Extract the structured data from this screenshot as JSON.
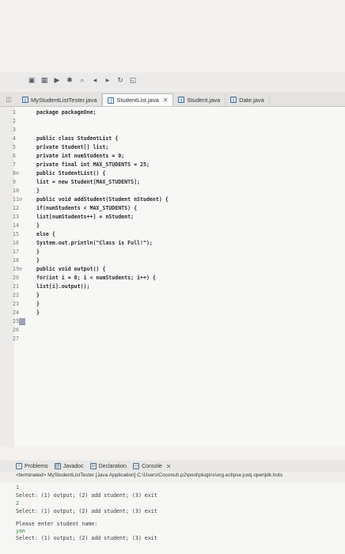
{
  "toolbar": {
    "icons": [
      "run-icon",
      "debug-icon",
      "search-icon",
      "back-icon",
      "forward-icon"
    ]
  },
  "editor_tabs": [
    {
      "label": "MyStudentListTester.java",
      "active": false
    },
    {
      "label": "StudentList.java",
      "active": true
    },
    {
      "label": "Student.java",
      "active": false
    },
    {
      "label": "Date.java",
      "active": false
    }
  ],
  "code_lines": [
    {
      "n": "1",
      "text": "package packageOne;"
    },
    {
      "n": "2",
      "text": ""
    },
    {
      "n": "3",
      "text": ""
    },
    {
      "n": "4",
      "text": "public class StudentList {"
    },
    {
      "n": "5",
      "text": "private Student[] list;"
    },
    {
      "n": "6",
      "text": "private int numStudents = 0;"
    },
    {
      "n": "7",
      "text": "private final int MAX_STUDENTS = 25;"
    },
    {
      "n": "8⊖",
      "text": "public StudentList() {"
    },
    {
      "n": "9",
      "text": "list = new Student[MAX_STUDENTS];"
    },
    {
      "n": "10",
      "text": "}"
    },
    {
      "n": "11⊖",
      "text": "public void addStudent(Student nStudent) {"
    },
    {
      "n": "12",
      "text": "if(numStudents < MAX_STUDENTS) {"
    },
    {
      "n": "13",
      "text": "list[numStudents++] = nStudent;"
    },
    {
      "n": "14",
      "text": "}"
    },
    {
      "n": "15",
      "text": "else {"
    },
    {
      "n": "16",
      "text": "System.out.println(\"Class is Full!\");"
    },
    {
      "n": "17",
      "text": "}"
    },
    {
      "n": "18",
      "text": "}"
    },
    {
      "n": "19⊖",
      "text": "public void output() {"
    },
    {
      "n": "20",
      "text": "for(int i = 0; i < numStudents; i++) {"
    },
    {
      "n": "21",
      "text": "list[i].output();"
    },
    {
      "n": "22",
      "text": "}"
    },
    {
      "n": "23",
      "text": "}"
    },
    {
      "n": "24",
      "text": "}"
    },
    {
      "n": "25",
      "text": ""
    },
    {
      "n": "26",
      "text": ""
    },
    {
      "n": "27",
      "text": ""
    }
  ],
  "views": [
    {
      "label": "Problems"
    },
    {
      "label": "Javadoc"
    },
    {
      "label": "Declaration"
    },
    {
      "label": "Console",
      "active": true
    }
  ],
  "console": {
    "header": "<terminated> MyStudentListTester [Java Application] C:\\Users\\Coconut\\.p2\\pool\\plugins\\org.eclipse.justj.openjdk.hots",
    "lines": [
      {
        "text": "1",
        "input": true
      },
      {
        "text": "Select: (1) output; (2) add student; (3) exit",
        "input": false
      },
      {
        "text": "2",
        "input": true
      },
      {
        "text": "Select: (1) output; (2) add student; (3) exit",
        "input": false
      },
      {
        "text": "",
        "input": false
      },
      {
        "text": "Please enter student name:",
        "input": false
      },
      {
        "text": "yan",
        "input": true
      },
      {
        "text": "Select: (1) output; (2) add student; (3) exit",
        "input": false
      }
    ]
  }
}
